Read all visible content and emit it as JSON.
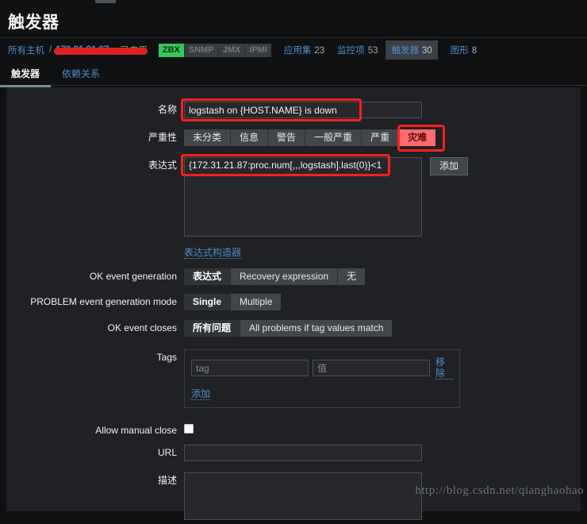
{
  "header": {
    "title": "触发器"
  },
  "breadcrumb": {
    "all_hosts": "所有主机",
    "separator": "/",
    "host_redacted": "",
    "host_ip": "172.31.21.87",
    "status": "已启用",
    "protocols": [
      {
        "label": "ZBX",
        "enabled": true
      },
      {
        "label": "SNMP",
        "enabled": false
      },
      {
        "label": "JMX",
        "enabled": false
      },
      {
        "label": "IPMI",
        "enabled": false
      }
    ],
    "counts": [
      {
        "label": "应用集",
        "value": "23",
        "active": false
      },
      {
        "label": "监控项",
        "value": "53",
        "active": false
      },
      {
        "label": "触发器",
        "value": "30",
        "active": true
      },
      {
        "label": "图形",
        "value": "8",
        "active": false
      }
    ]
  },
  "tabs": [
    {
      "label": "触发器",
      "active": true
    },
    {
      "label": "依赖关系",
      "active": false
    }
  ],
  "form": {
    "name": {
      "label": "名称",
      "value": "logstash on {HOST.NAME} is down",
      "placeholder": ""
    },
    "severity": {
      "label": "严重性",
      "options": [
        "未分类",
        "信息",
        "警告",
        "一般严重",
        "严重",
        "灾难"
      ],
      "selected": "灾难"
    },
    "expression": {
      "label": "表达式",
      "value": "{172.31.21.87:proc.num[,,,logstash].last(0)}<1",
      "add_button": "添加",
      "constructor_link": "表达式构造器"
    },
    "ok_event_generation": {
      "label": "OK event generation",
      "options": [
        "表达式",
        "Recovery expression",
        "无"
      ],
      "selected": "表达式"
    },
    "problem_event_mode": {
      "label": "PROBLEM event generation mode",
      "options": [
        "Single",
        "Multiple"
      ],
      "selected": "Single"
    },
    "ok_event_closes": {
      "label": "OK event closes",
      "options": [
        "所有问题",
        "All problems if tag values match"
      ],
      "selected": "所有问题"
    },
    "tags": {
      "label": "Tags",
      "key_placeholder": "tag",
      "key_value": "",
      "value_placeholder": "值",
      "value_value": "",
      "remove_link": "移除",
      "add_link": "添加"
    },
    "allow_manual_close": {
      "label": "Allow manual close",
      "checked": false
    },
    "url": {
      "label": "URL",
      "value": "",
      "placeholder": ""
    },
    "description": {
      "label": "描述",
      "value": "",
      "placeholder": ""
    }
  },
  "watermark": "http://blog.csdn.net/qianghaohao",
  "colors": {
    "page_bg": "#0f1113",
    "panel_bg": "#1f2124",
    "link": "#4f8ccc",
    "ok_green": "#59b359",
    "zbx_green": "#34c759",
    "disaster_red": "#ff6a6a",
    "annotation_red": "#ff1f1f"
  }
}
